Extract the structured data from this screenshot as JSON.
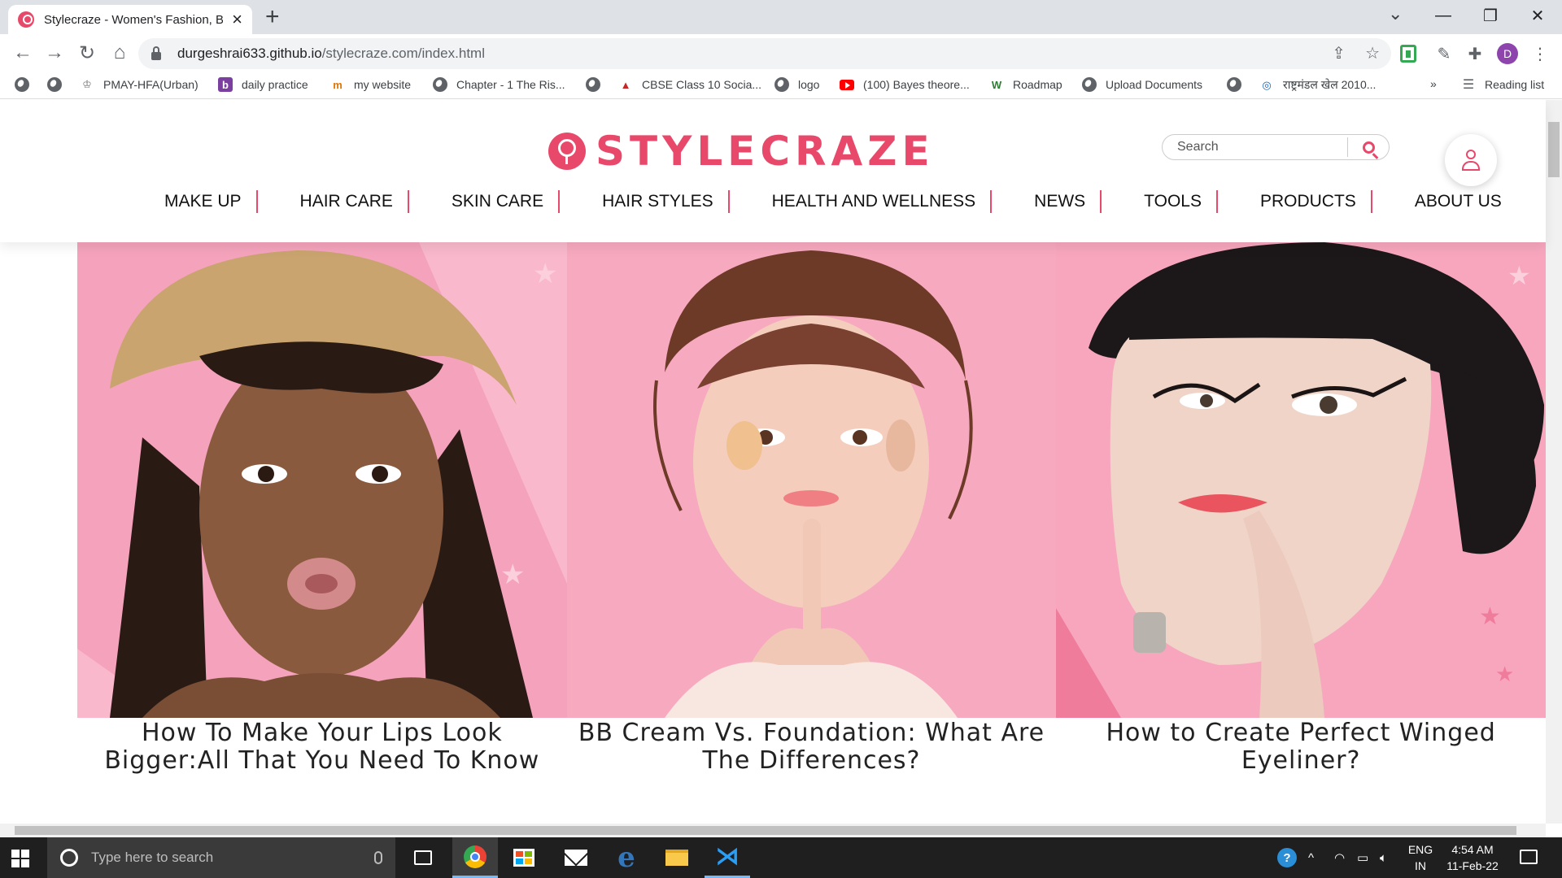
{
  "browser": {
    "tab_title": "Stylecraze - Women's Fashion, Be",
    "url_host": "durgeshrai633.github.io",
    "url_path": "/stylecraze.com/index.html",
    "profile_initial": "D",
    "reading_list": "Reading list",
    "bookmarks": [
      {
        "label": "",
        "icon": "globe-icon"
      },
      {
        "label": "",
        "icon": "globe-icon"
      },
      {
        "label": "PMAY-HFA(Urban)",
        "icon": "emblem-icon"
      },
      {
        "label": "daily practice",
        "icon": "b-logo-icon"
      },
      {
        "label": "my website",
        "icon": "m-logo-icon"
      },
      {
        "label": "Chapter - 1 The Ris...",
        "icon": "globe-icon"
      },
      {
        "label": "",
        "icon": "globe-icon"
      },
      {
        "label": "CBSE Class 10 Socia...",
        "icon": "cap-icon"
      },
      {
        "label": "logo",
        "icon": "globe-icon"
      },
      {
        "label": "(100) Bayes theore...",
        "icon": "youtube-icon"
      },
      {
        "label": "Roadmap",
        "icon": "w-logo-icon"
      },
      {
        "label": "Upload Documents",
        "icon": "globe-icon"
      },
      {
        "label": "",
        "icon": "globe-icon"
      },
      {
        "label": "राष्ट्रमंडल खेल 2010...",
        "icon": "ring-icon"
      }
    ],
    "bookmarks_more": "»"
  },
  "site": {
    "logo_text": "STYLECRAZE",
    "search_placeholder": "Search",
    "nav": [
      "MAKE UP",
      "HAIR CARE",
      "SKIN CARE",
      "HAIR STYLES",
      "HEALTH AND WELLNESS",
      "NEWS",
      "TOOLS",
      "PRODUCTS",
      "ABOUT US"
    ],
    "articles": [
      {
        "title": "How To Make Your Lips Look Bigger:All That You Need To Know"
      },
      {
        "title": "BB Cream Vs. Foundation: What Are The Differences?"
      },
      {
        "title": "How to Create Perfect Winged Eyeliner?"
      }
    ]
  },
  "taskbar": {
    "search_placeholder": "Type here to search",
    "lang_top": "ENG",
    "lang_bottom": "IN",
    "time": "4:54 AM",
    "date": "11-Feb-22"
  },
  "colors": {
    "brand": "#e8496a",
    "hero_pink": "#f5a3bd"
  }
}
